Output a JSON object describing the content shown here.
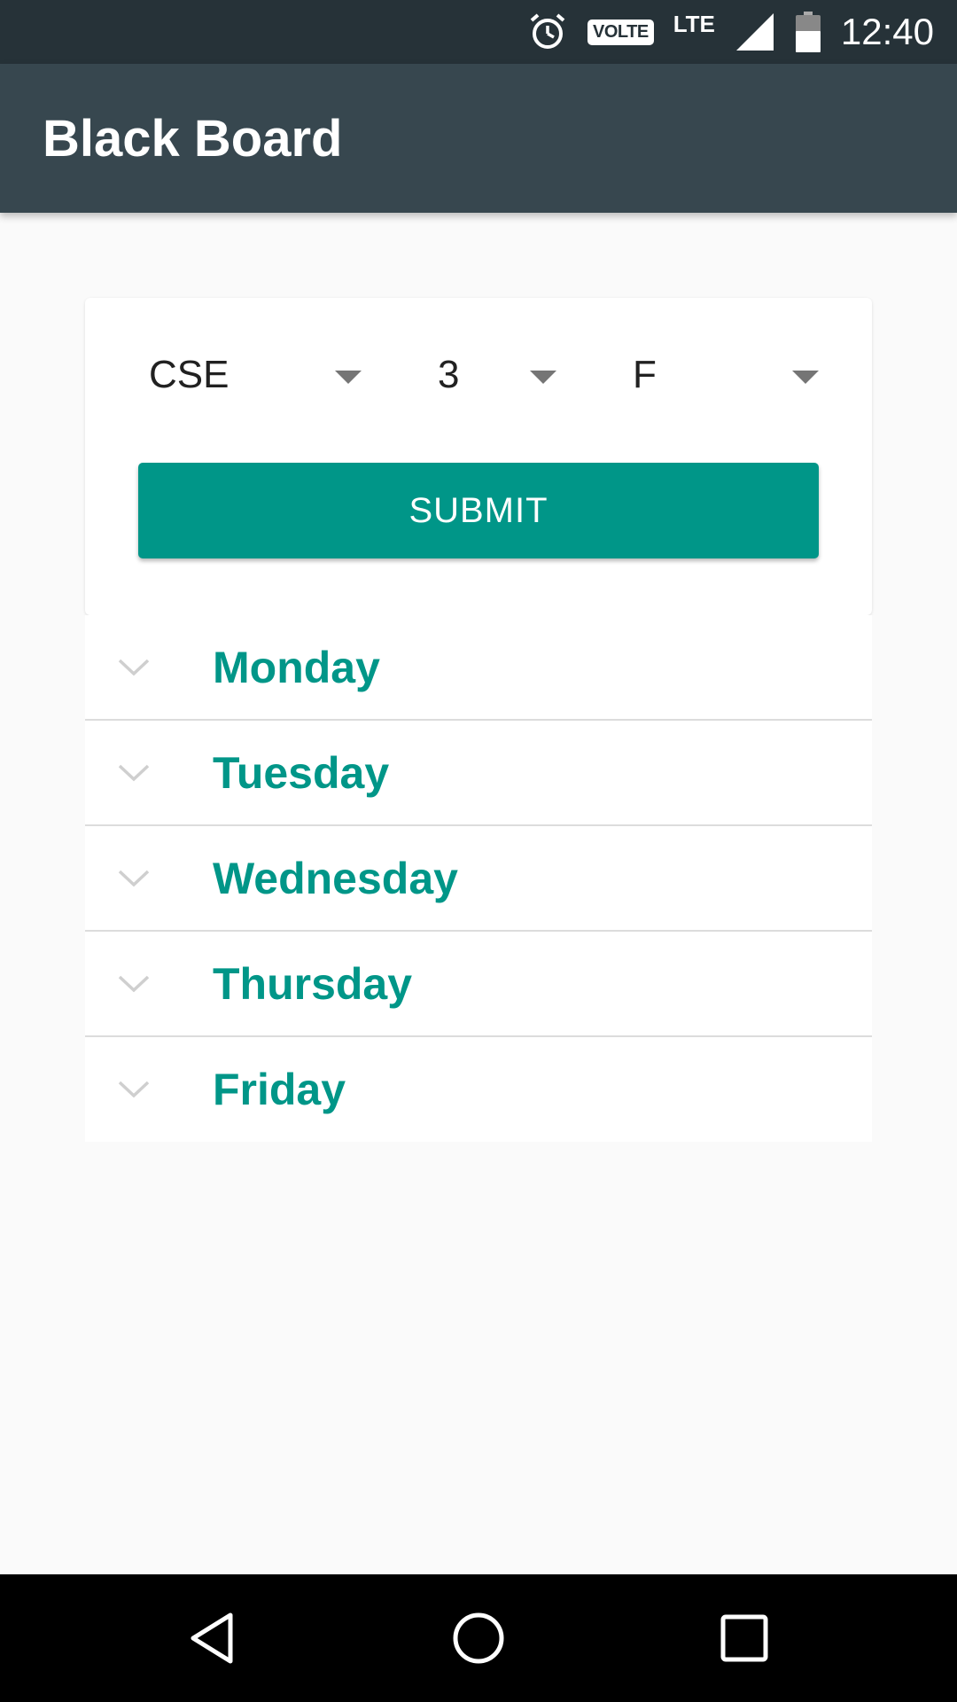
{
  "status_bar": {
    "volte_label": "VOLTE",
    "network_label": "LTE",
    "time": "12:40",
    "icons": [
      "alarm-icon",
      "signal-icon",
      "battery-icon"
    ]
  },
  "app_bar": {
    "title": "Black Board"
  },
  "filters": {
    "department": "CSE",
    "year": "3",
    "section": "F"
  },
  "submit_label": "SUBMIT",
  "days": [
    {
      "label": "Monday"
    },
    {
      "label": "Tuesday"
    },
    {
      "label": "Wednesday"
    },
    {
      "label": "Thursday"
    },
    {
      "label": "Friday"
    }
  ],
  "navigation": {
    "icons": [
      "back-icon",
      "home-icon",
      "recents-icon"
    ]
  },
  "colors": {
    "status_bar": "#263238",
    "app_bar": "#37474f",
    "accent": "#009688",
    "background": "#fafafa"
  }
}
